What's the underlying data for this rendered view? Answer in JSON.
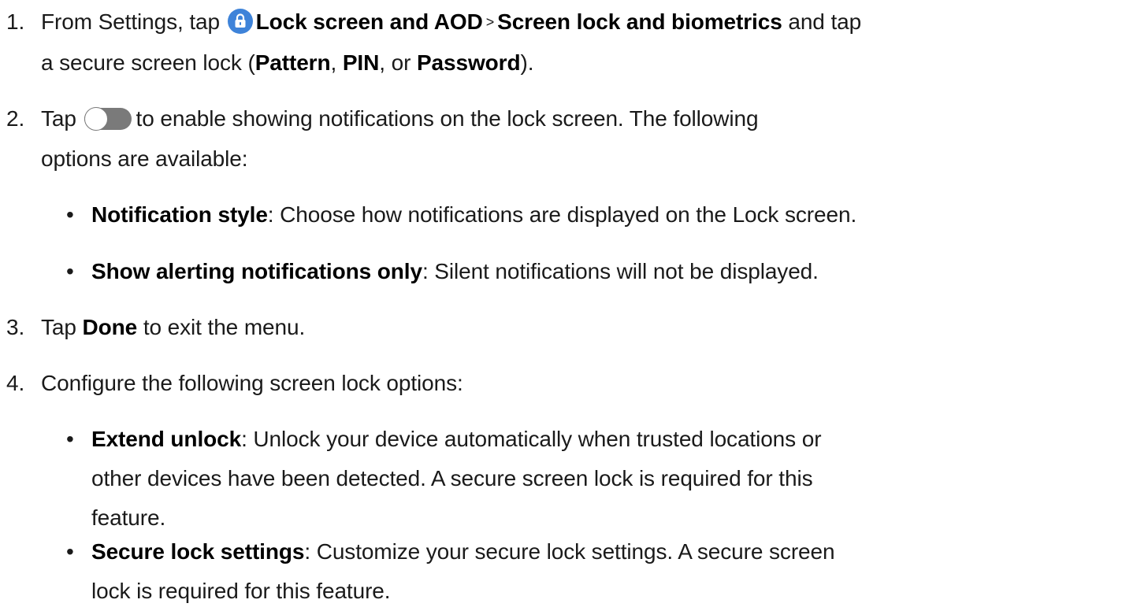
{
  "steps": [
    {
      "number": "1.",
      "line1": {
        "pre": "From Settings, tap",
        "menu1": "Lock screen and AOD",
        "separator": ">",
        "menu2": "Screen lock and biometrics",
        "post": "and tap"
      },
      "line2": {
        "pre": "a secure screen lock (",
        "opt1": "Pattern",
        "sep1": ", ",
        "opt2": "PIN",
        "sep2": ", or ",
        "opt3": "Password",
        "post": ")."
      }
    },
    {
      "number": "2.",
      "line1": {
        "pre": "Tap",
        "post": "to enable showing notifications on the lock screen. The following"
      },
      "line2": "options are available:",
      "bullets": [
        {
          "term": "Notification style",
          "desc": ": Choose how notifications are displayed on the Lock screen."
        },
        {
          "term": "Show alerting notifications only",
          "desc": ": Silent notifications will not be displayed."
        }
      ]
    },
    {
      "number": "3.",
      "pre": "Tap",
      "term": "Done",
      "post": "to exit the menu."
    },
    {
      "number": "4.",
      "text": "Configure the following screen lock options:",
      "bullets": [
        {
          "term": "Extend unlock",
          "desc_line1": ": Unlock your device automatically when trusted locations or",
          "desc_line2": "other devices have been detected. A secure screen lock is required for this",
          "desc_line3": "feature."
        },
        {
          "term": "Secure lock settings",
          "desc_line1": ": Customize your secure lock settings. A secure screen",
          "desc_line2": "lock is required for this feature."
        }
      ]
    }
  ],
  "bullet_glyph": "•",
  "icons": {
    "lock": "lock-icon",
    "toggle": "toggle-switch-icon"
  },
  "colors": {
    "lock_icon_bg": "#3e83d9",
    "toggle_bg": "#7a7a7a",
    "text": "#1a1a1a"
  }
}
